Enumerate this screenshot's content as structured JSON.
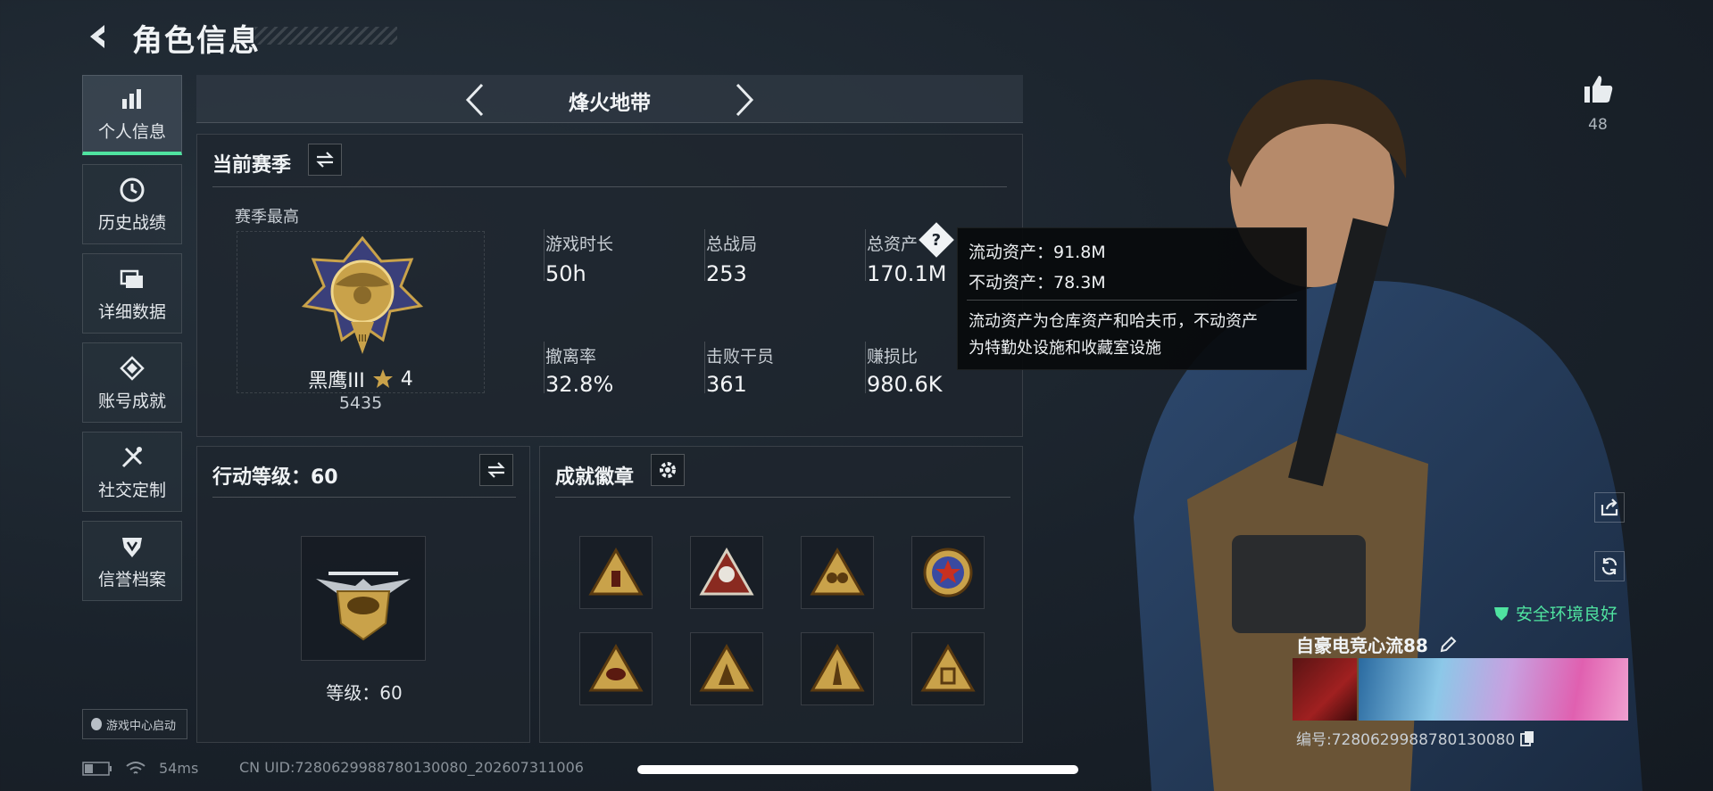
{
  "header": {
    "title": "角色信息"
  },
  "sidebar": {
    "items": [
      {
        "label": "个人信息",
        "icon": "bar-chart-icon",
        "active": true
      },
      {
        "label": "历史战绩",
        "icon": "clock-history-icon",
        "active": false
      },
      {
        "label": "详细数据",
        "icon": "folder-stack-icon",
        "active": false
      },
      {
        "label": "账号成就",
        "icon": "achievement-diamond-icon",
        "active": false
      },
      {
        "label": "社交定制",
        "icon": "tools-icon",
        "active": false
      },
      {
        "label": "信誉档案",
        "icon": "shield-badge-icon",
        "active": false
      }
    ]
  },
  "mode_selector": {
    "current": "烽火地带"
  },
  "season": {
    "title": "当前赛季",
    "best_label": "赛季最高",
    "rank_name": "黑鹰III",
    "rank_stars": "4",
    "rank_points": "5435",
    "stats": [
      {
        "label": "游戏时长",
        "value": "50h"
      },
      {
        "label": "总战局",
        "value": "253"
      },
      {
        "label": "总资产",
        "value": "170.1M"
      },
      {
        "label": "撤离率",
        "value": "32.8%"
      },
      {
        "label": "击败干员",
        "value": "361"
      },
      {
        "label": "赚损比",
        "value": "980.6K"
      }
    ]
  },
  "tooltip": {
    "liquid": "流动资产：91.8M",
    "fixed": "不动资产：78.3M",
    "desc_line1": "流动资产为仓库资产和哈夫币，不动资产",
    "desc_line2": "为特勤处设施和收藏室设施"
  },
  "action_level": {
    "title": "行动等级：60",
    "level_text": "等级：60"
  },
  "achievements": {
    "title": "成就徽章",
    "badges": [
      "badge-1",
      "badge-2",
      "badge-3",
      "badge-4",
      "badge-5",
      "badge-6",
      "badge-7",
      "badge-8"
    ]
  },
  "game_center": {
    "label": "游戏中心启动"
  },
  "status_bar": {
    "ping": "54ms",
    "uid": "CN UID:7280629988780130080_202607311006"
  },
  "profile": {
    "likes": "48",
    "env_status": "安全环境良好",
    "player_name": "自豪电竞心流88",
    "player_id": "编号:7280629988780130080"
  },
  "colors": {
    "accent_green": "#4fe3a0",
    "gold": "#c9a24a",
    "background": "#1a222b"
  }
}
